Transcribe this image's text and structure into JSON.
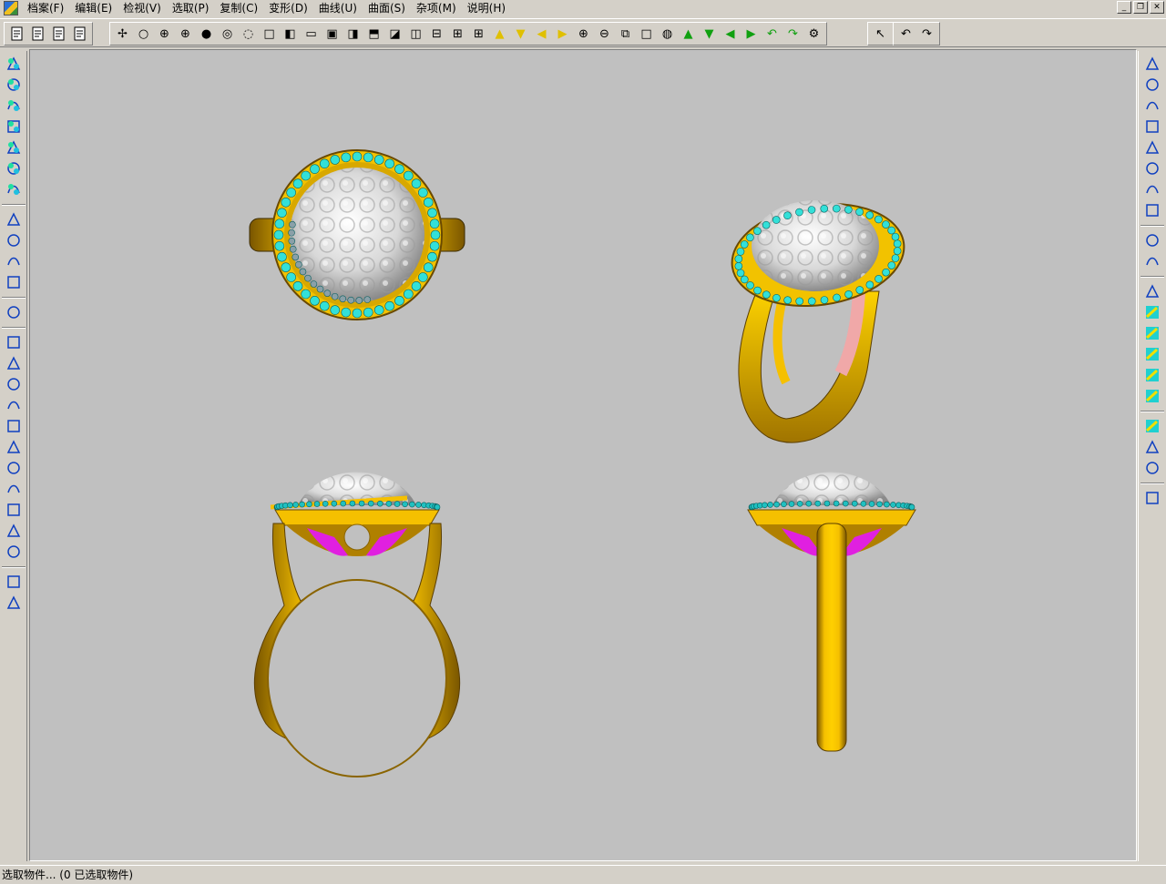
{
  "app": {
    "icon": "rhino-app-icon"
  },
  "menu": [
    {
      "label": "档案(F)"
    },
    {
      "label": "编辑(E)"
    },
    {
      "label": "检视(V)"
    },
    {
      "label": "选取(P)"
    },
    {
      "label": "复制(C)"
    },
    {
      "label": "变形(D)"
    },
    {
      "label": "曲线(U)"
    },
    {
      "label": "曲面(S)"
    },
    {
      "label": "杂项(M)"
    },
    {
      "label": "说明(H)"
    }
  ],
  "window_controls": [
    {
      "icon": "minimize-icon",
      "glyph": "_"
    },
    {
      "icon": "restore-icon",
      "glyph": "❐"
    },
    {
      "icon": "close-icon",
      "glyph": "✕"
    }
  ],
  "toolbar": {
    "file_tools": [
      {
        "icon": "new-file-icon"
      },
      {
        "icon": "open-folder-icon"
      },
      {
        "icon": "save-icon"
      },
      {
        "icon": "help-pointer-icon"
      }
    ],
    "view_tools": [
      {
        "icon": "point-select-icon",
        "glyph": "✢"
      },
      {
        "icon": "circle-outline-icon",
        "glyph": "○"
      },
      {
        "icon": "circle-cross-icon",
        "glyph": "⊕"
      },
      {
        "icon": "circle-grid-icon",
        "glyph": "⊕"
      },
      {
        "icon": "filled-circle-icon",
        "glyph": "●"
      },
      {
        "icon": "ring-circle-icon",
        "glyph": "◎"
      },
      {
        "icon": "dotted-circle-icon",
        "glyph": "◌"
      },
      {
        "icon": "square-outline-icon",
        "glyph": "□"
      },
      {
        "icon": "square-left-half-icon",
        "glyph": "◧"
      },
      {
        "icon": "square-bottom-icon",
        "glyph": "▭"
      },
      {
        "icon": "square-bold-icon",
        "glyph": "▣"
      },
      {
        "icon": "square-right-half-icon",
        "glyph": "◨"
      },
      {
        "icon": "square-top-icon",
        "glyph": "⬒"
      },
      {
        "icon": "square-corner-icon",
        "glyph": "◪"
      },
      {
        "icon": "split-vertical-icon",
        "glyph": "◫"
      },
      {
        "icon": "split-horizontal-icon",
        "glyph": "⊟"
      },
      {
        "icon": "split-quad-icon",
        "glyph": "⊞"
      },
      {
        "icon": "split-quad-bold-icon",
        "glyph": "⊞"
      },
      {
        "icon": "arrow-up-yellow-icon",
        "glyph": "▲"
      },
      {
        "icon": "arrow-down-yellow-icon",
        "glyph": "▼"
      },
      {
        "icon": "arrow-left-yellow-icon",
        "glyph": "◀"
      },
      {
        "icon": "arrow-right-yellow-icon",
        "glyph": "▶"
      },
      {
        "icon": "zoom-in-icon",
        "glyph": "⊕"
      },
      {
        "icon": "zoom-out-icon",
        "glyph": "⊖"
      },
      {
        "icon": "zoom-window-icon",
        "glyph": "⧉"
      },
      {
        "icon": "zoom-extents-icon",
        "glyph": "□"
      },
      {
        "icon": "zoom-dynamic-icon",
        "glyph": "◍"
      },
      {
        "icon": "arrow-up-green-icon",
        "glyph": "▲"
      },
      {
        "icon": "arrow-down-green-icon",
        "glyph": "▼"
      },
      {
        "icon": "arrow-left-green-icon",
        "glyph": "◀"
      },
      {
        "icon": "arrow-right-green-icon",
        "glyph": "▶"
      },
      {
        "icon": "rotate-left-green-icon",
        "glyph": "↶"
      },
      {
        "icon": "rotate-right-green-icon",
        "glyph": "↷"
      },
      {
        "icon": "render-icon",
        "glyph": "⚙"
      }
    ],
    "select_tools": [
      {
        "icon": "select-arrow-icon",
        "glyph": "↖"
      }
    ],
    "undo_tools": [
      {
        "icon": "undo-icon",
        "glyph": "↶"
      },
      {
        "icon": "redo-icon",
        "glyph": "↷"
      }
    ]
  },
  "left_palette": [
    {
      "icon": "select-points-icon"
    },
    {
      "icon": "move-objects-icon"
    },
    {
      "icon": "scale-objects-icon"
    },
    {
      "icon": "array-objects-icon"
    },
    {
      "icon": "grid-array-icon"
    },
    {
      "icon": "curve-array-icon"
    },
    {
      "icon": "polar-array-icon"
    },
    {
      "icon": "sep"
    },
    {
      "icon": "plane-surface-icon"
    },
    {
      "icon": "box-frame-icon"
    },
    {
      "icon": "extrude-icon"
    },
    {
      "icon": "mirror-icon"
    },
    {
      "icon": "sep"
    },
    {
      "icon": "cross-points-icon"
    },
    {
      "icon": "sep"
    },
    {
      "icon": "bend-icon"
    },
    {
      "icon": "twist-icon"
    },
    {
      "icon": "taper-icon"
    },
    {
      "icon": "taper-bold-icon"
    },
    {
      "icon": "taper-small-icon"
    },
    {
      "icon": "taper-bold-small-icon"
    },
    {
      "icon": "shear-icon"
    },
    {
      "icon": "shear-bold-icon"
    },
    {
      "icon": "bowtie-icon"
    },
    {
      "icon": "loop-icon"
    },
    {
      "icon": "squiggle-icon"
    },
    {
      "icon": "sep"
    },
    {
      "icon": "angle-icon"
    },
    {
      "icon": "align-bottom-icon"
    }
  ],
  "right_palette": [
    {
      "icon": "polyline-icon"
    },
    {
      "icon": "curve-points-icon"
    },
    {
      "icon": "interp-curve-icon"
    },
    {
      "icon": "sketch-curve-icon"
    },
    {
      "icon": "rectangle-points-icon"
    },
    {
      "icon": "line-icon"
    },
    {
      "icon": "control-points-icon"
    },
    {
      "icon": "circle-icon"
    },
    {
      "icon": "sep"
    },
    {
      "icon": "ellipse-icon"
    },
    {
      "icon": "arc-icon"
    },
    {
      "icon": "sep"
    },
    {
      "icon": "surface-loft-icon"
    },
    {
      "icon": "surface-revolve-icon"
    },
    {
      "icon": "surface-sweep-icon"
    },
    {
      "icon": "surface-network-icon"
    },
    {
      "icon": "surface-blend-icon"
    },
    {
      "icon": "surface-patch-icon"
    },
    {
      "icon": "sep"
    },
    {
      "icon": "duplicate-icon"
    },
    {
      "icon": "point-icon"
    },
    {
      "icon": "corner-icon"
    },
    {
      "icon": "sep"
    },
    {
      "icon": "blank-icon"
    }
  ],
  "viewport": {
    "background": "#c0c0c0",
    "views": [
      {
        "name": "top-view-ring"
      },
      {
        "name": "perspective-view-ring"
      },
      {
        "name": "front-view-ring"
      },
      {
        "name": "side-view-ring"
      }
    ],
    "colors": {
      "gold": "#f5c000",
      "gold_dark": "#8a6400",
      "stone": "#33e0d8",
      "pearl": "#e8e8e8",
      "magenta": "#e020e0",
      "pink": "#f0a8a8",
      "grey_stone": "#8aa0a8"
    }
  },
  "status": {
    "text": "选取物件... (0 已选取物件)"
  }
}
